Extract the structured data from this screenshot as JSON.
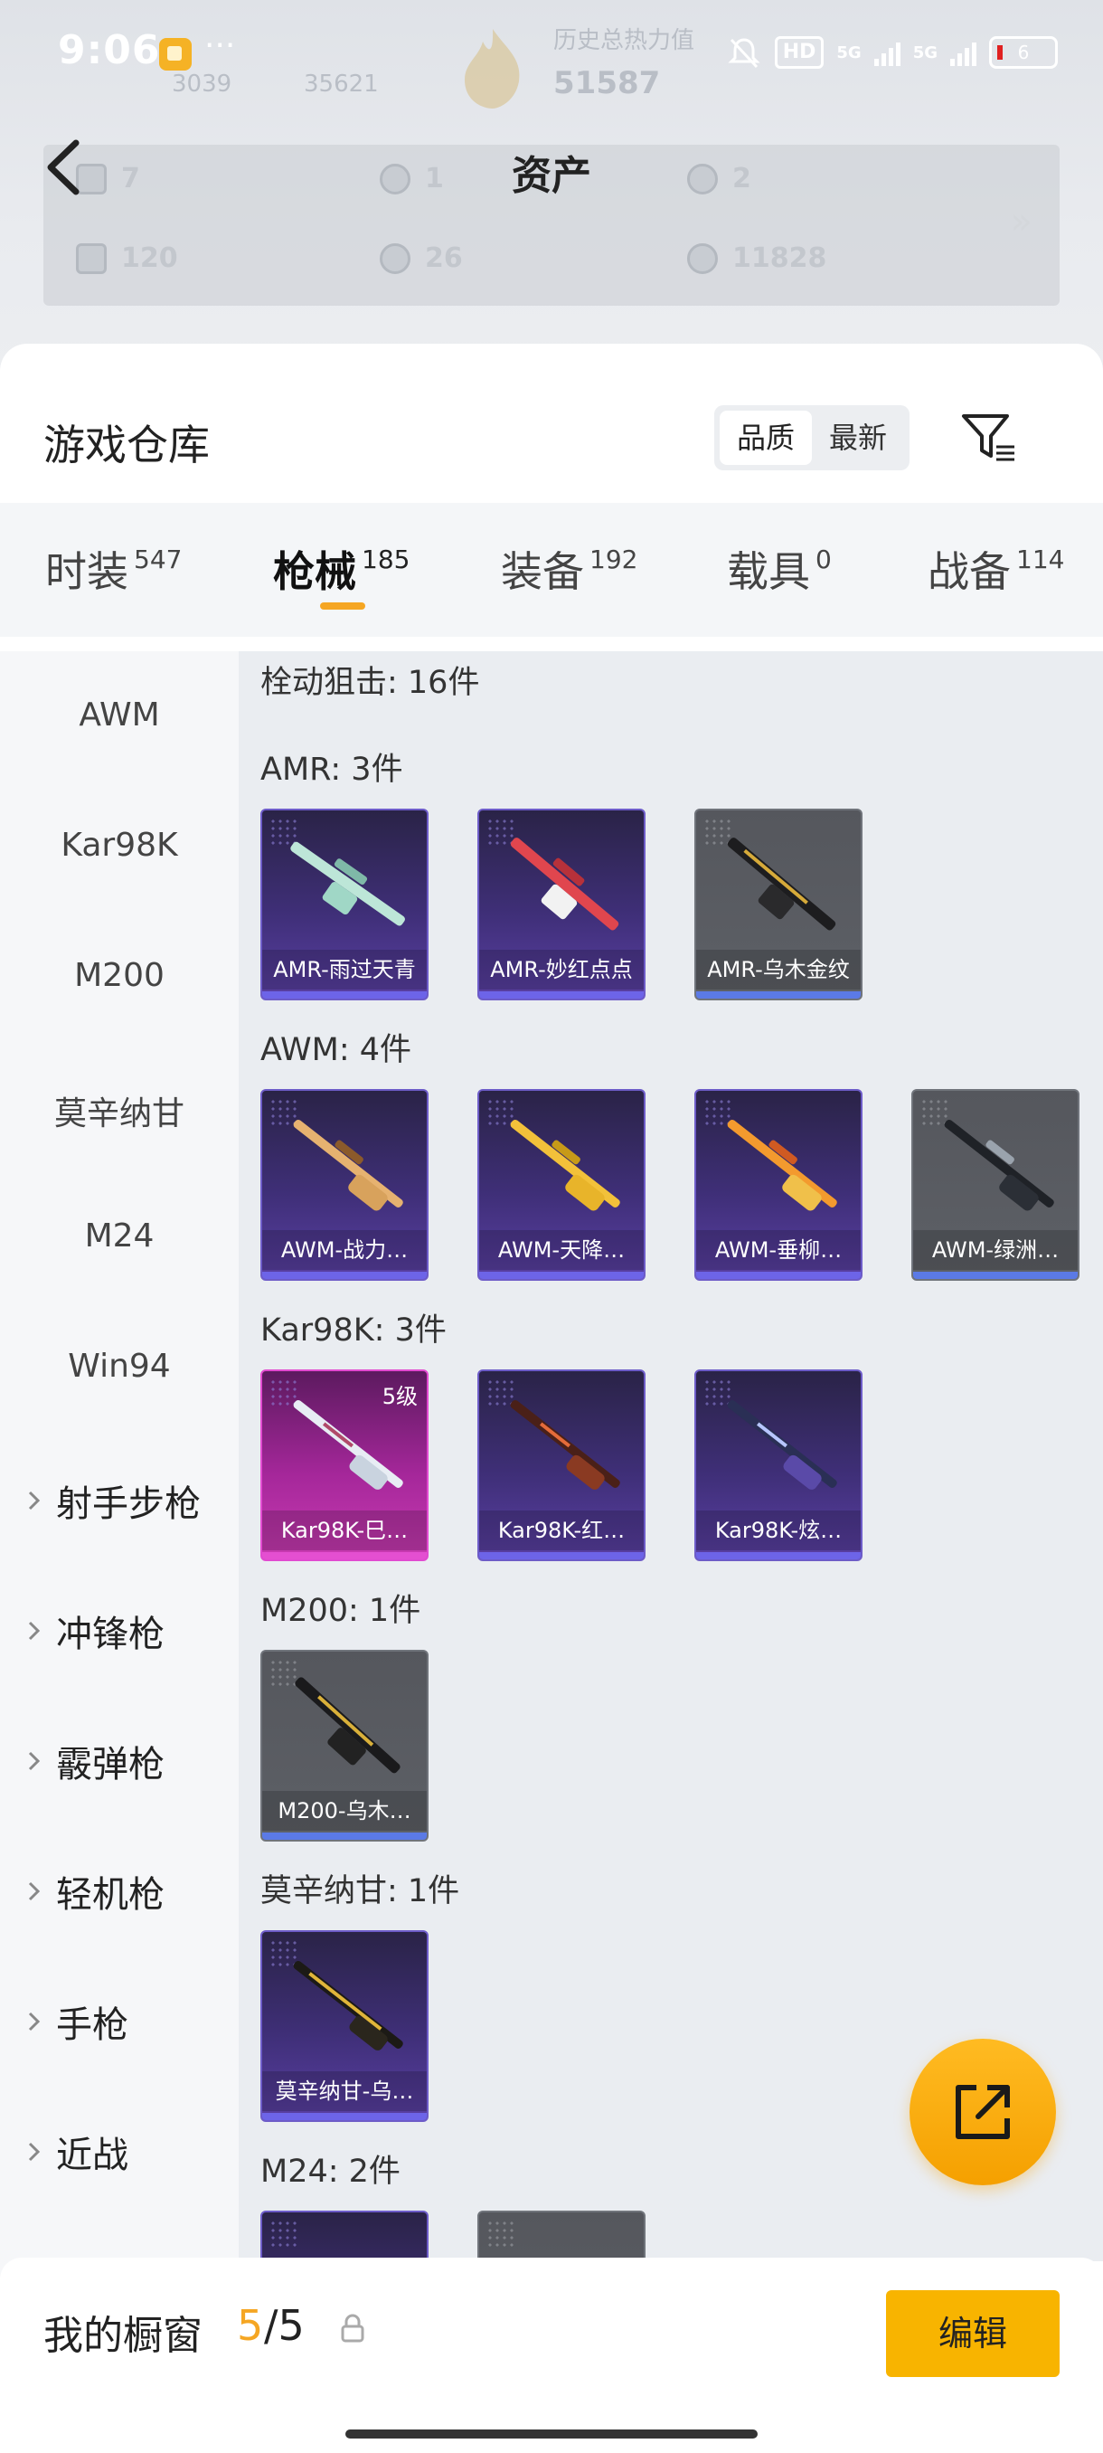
{
  "status_bar": {
    "time": "9:06",
    "more": "···",
    "hd": "HD",
    "net1": "5G",
    "net2": "5G",
    "battery": "6"
  },
  "header": {
    "title": "资产",
    "faded_top": {
      "label": "历史总热力值",
      "value": "51587",
      "v1": "3039",
      "v2": "35621"
    },
    "assets": [
      {
        "value": "7"
      },
      {
        "value": "1"
      },
      {
        "value": "2"
      },
      {
        "value": "120"
      },
      {
        "value": "26"
      },
      {
        "value": "11828"
      }
    ],
    "more_arrow": "»"
  },
  "warehouse": {
    "title": "游戏仓库",
    "sort_options": [
      "品质",
      "最新"
    ],
    "active_sort": "品质"
  },
  "tabs": [
    {
      "label": "时装",
      "count": "547"
    },
    {
      "label": "枪械",
      "count": "185"
    },
    {
      "label": "装备",
      "count": "192"
    },
    {
      "label": "载具",
      "count": "0"
    },
    {
      "label": "战备",
      "count": "114"
    }
  ],
  "sidebar": {
    "items": [
      "AWM",
      "Kar98K",
      "M200",
      "莫辛纳甘",
      "M24",
      "Win94"
    ],
    "groups": [
      "射手步枪",
      "冲锋枪",
      "霰弹枪",
      "轻机枪",
      "手枪",
      "近战"
    ]
  },
  "content": {
    "category_header": "栓动狙击: 16件",
    "sections": [
      {
        "label": "AMR: 3件",
        "items": [
          {
            "name": "AMR-雨过天青",
            "style": "purple"
          },
          {
            "name": "AMR-妙红点点",
            "style": "purple"
          },
          {
            "name": "AMR-乌木金纹",
            "style": "grey"
          }
        ]
      },
      {
        "label": "AWM: 4件",
        "items": [
          {
            "name": "AWM-战力…",
            "style": "purple"
          },
          {
            "name": "AWM-天降…",
            "style": "purple"
          },
          {
            "name": "AWM-垂柳…",
            "style": "purple"
          },
          {
            "name": "AWM-绿洲…",
            "style": "grey"
          }
        ]
      },
      {
        "label": "Kar98K: 3件",
        "items": [
          {
            "name": "Kar98K-巳…",
            "style": "pink",
            "level": "5级"
          },
          {
            "name": "Kar98K-红…",
            "style": "purple"
          },
          {
            "name": "Kar98K-炫…",
            "style": "purple"
          }
        ]
      },
      {
        "label": "M200: 1件",
        "items": [
          {
            "name": "M200-乌木…",
            "style": "grey"
          }
        ]
      },
      {
        "label": "莫辛纳甘: 1件",
        "items": [
          {
            "name": "莫辛纳甘-乌…",
            "style": "purple"
          }
        ]
      },
      {
        "label": "M24: 2件",
        "items": [
          {
            "name": "",
            "style": "purple"
          },
          {
            "name": "",
            "style": "grey"
          }
        ]
      }
    ]
  },
  "bottom": {
    "title": "我的橱窗",
    "current": "5",
    "separator_total": "/5",
    "edit_label": "编辑"
  },
  "colors": {
    "accent": "#f5a623",
    "edit_button": "#f8b400",
    "tile_purple": "#3f2f78",
    "tile_grey": "#5d6066",
    "tile_pink": "#a5279a"
  }
}
